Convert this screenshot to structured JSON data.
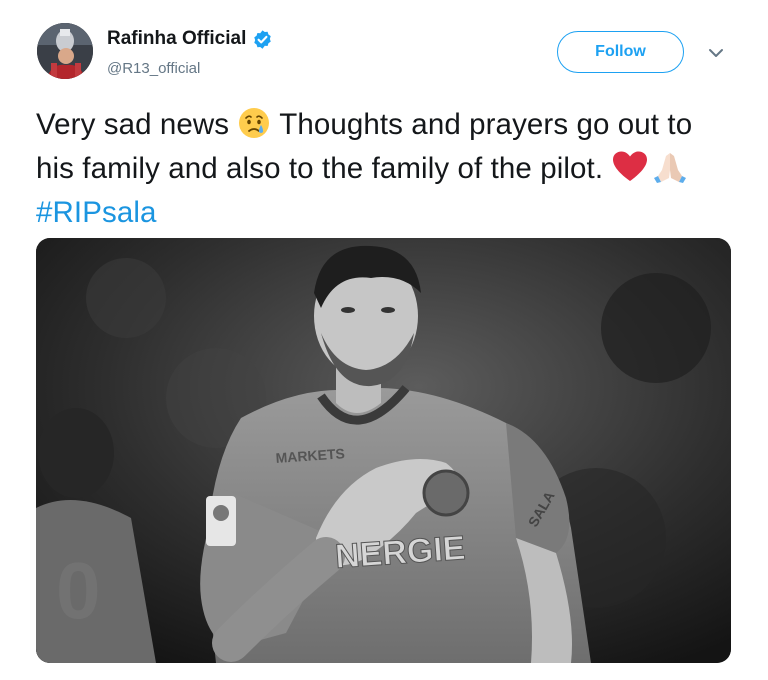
{
  "author": {
    "display_name": "Rafinha Official",
    "handle": "@R13_official",
    "verified": true,
    "avatar_icon": "avatar-photo"
  },
  "follow_button": {
    "label": "Follow"
  },
  "menu": {
    "icon": "chevron-down-icon"
  },
  "tweet": {
    "text_before_emoji": "Very sad news ",
    "text_after_emoji": " Thoughts and prayers go out to his family and also to the family of the pilot. ",
    "hashtag": "#RIPsala",
    "emojis": [
      "crying-face-icon",
      "red-heart-icon",
      "folded-hands-icon"
    ]
  },
  "media": {
    "type": "photo",
    "shirt_text": "NERGIE",
    "sleeve_text": "SALA"
  },
  "colors": {
    "accent": "#1da1f2",
    "hashtag": "#1b95e0",
    "text": "#14171a",
    "secondary_text": "#657786"
  }
}
